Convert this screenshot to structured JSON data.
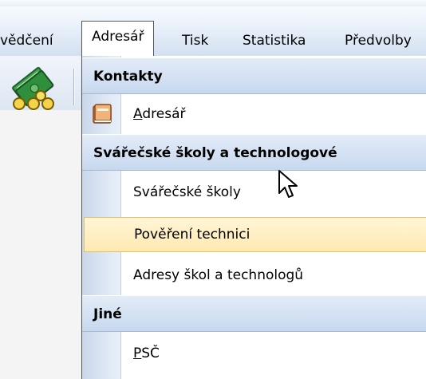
{
  "menubar": {
    "items": [
      {
        "label": "vědčení"
      },
      {
        "label": "Adresář"
      },
      {
        "label": "Tisk"
      },
      {
        "label": "Statistika"
      },
      {
        "label": "Předvolby"
      }
    ],
    "open_item": "Adresář"
  },
  "menu": {
    "sections": [
      {
        "header": "Kontakty",
        "items": [
          {
            "label_first": "A",
            "label_rest": "dresář",
            "icon": "address-book-icon"
          }
        ]
      },
      {
        "header": "Svářečské školy a technologové",
        "items": [
          {
            "label": "Svářečské školy"
          },
          {
            "label": "Pověření technici",
            "highlighted": true
          },
          {
            "label": "Adresy škol a technologů"
          }
        ]
      },
      {
        "header": "Jiné",
        "items": [
          {
            "label_first": "P",
            "label_rest": "SČ"
          }
        ]
      }
    ]
  },
  "colors": {
    "header_bg": "#c7d8ee",
    "highlight_bg": "#ffe9b2",
    "highlight_border": "#e5c365",
    "gutter": "#c9d7eb"
  }
}
